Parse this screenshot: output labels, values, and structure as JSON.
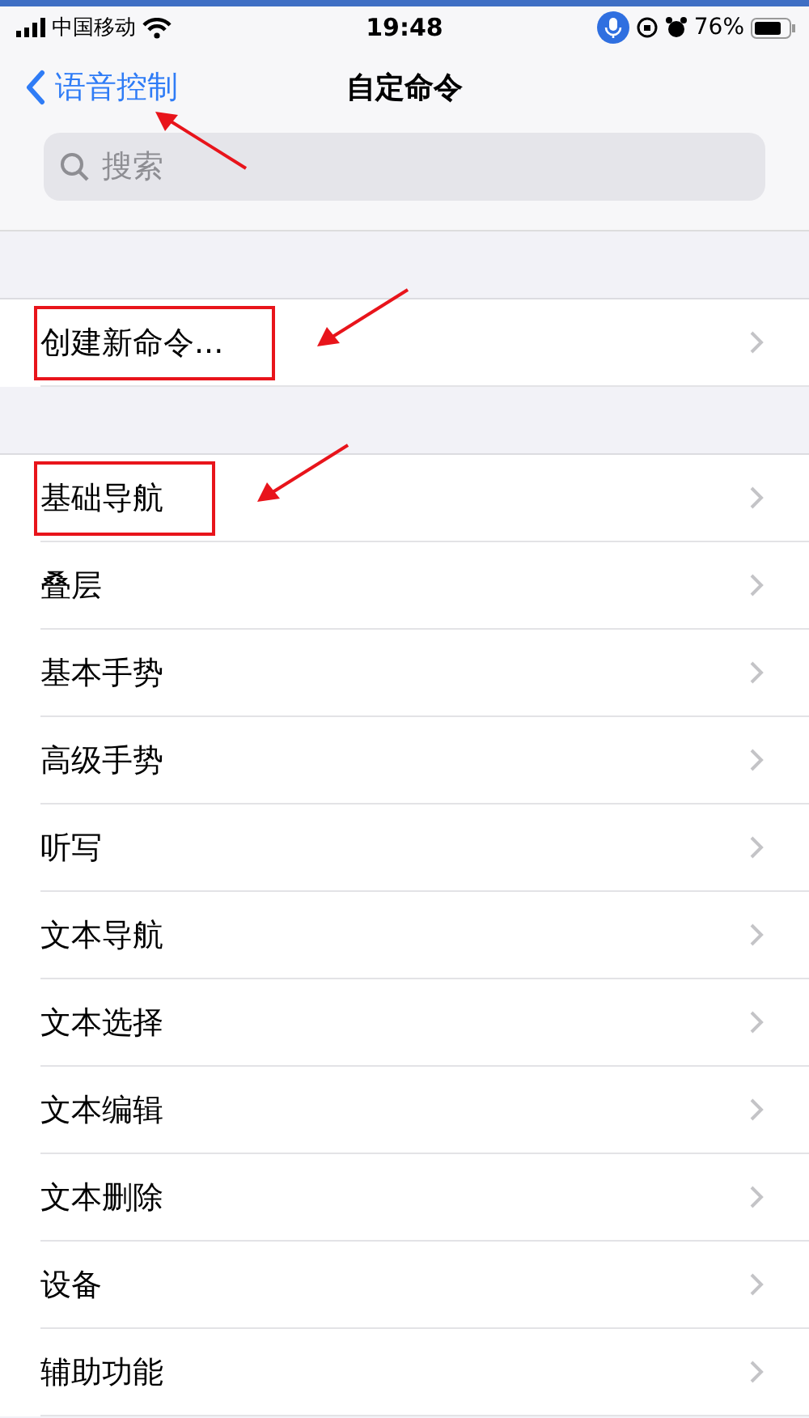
{
  "status_bar": {
    "carrier": "中国移动",
    "time": "19:48",
    "battery": "76%",
    "mic_active": true
  },
  "nav": {
    "back": "语音控制",
    "title": "自定命令",
    "back_annotated": true
  },
  "search": {
    "placeholder": "搜索"
  },
  "sections": [
    {
      "items": [
        {
          "label": "创建新命令...",
          "annotated": true
        }
      ]
    },
    {
      "items": [
        {
          "label": "基础导航",
          "annotated": true
        },
        {
          "label": "叠层",
          "annotated": false
        },
        {
          "label": "基本手势",
          "annotated": false
        },
        {
          "label": "高级手势",
          "annotated": false
        },
        {
          "label": "听写",
          "annotated": false
        },
        {
          "label": "文本导航",
          "annotated": false
        },
        {
          "label": "文本选择",
          "annotated": false
        },
        {
          "label": "文本编辑",
          "annotated": false
        },
        {
          "label": "文本删除",
          "annotated": false
        },
        {
          "label": "设备",
          "annotated": false
        },
        {
          "label": "辅助功能",
          "annotated": false
        }
      ]
    }
  ]
}
